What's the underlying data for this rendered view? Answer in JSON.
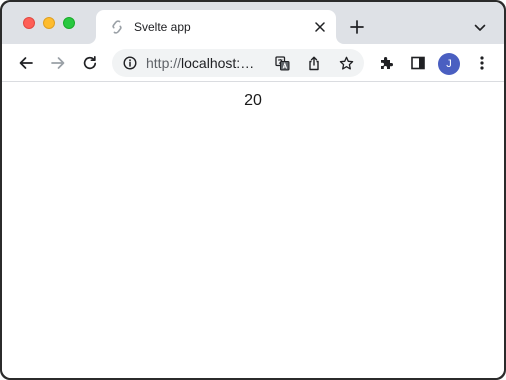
{
  "window": {
    "controls": [
      "close",
      "minimize",
      "zoom"
    ]
  },
  "tab": {
    "title": "Svelte app",
    "favicon": "svelte-icon"
  },
  "toolbar": {
    "url_scheme": "http://",
    "url_host": "localhost:",
    "icons": [
      "back-icon",
      "forward-icon",
      "reload-icon",
      "info-icon",
      "translate-icon",
      "share-icon",
      "star-icon",
      "extensions-icon",
      "side-panel-icon",
      "menu-icon"
    ]
  },
  "profile": {
    "initial": "J",
    "color": "#4a5fc1"
  },
  "page": {
    "value": "20"
  }
}
